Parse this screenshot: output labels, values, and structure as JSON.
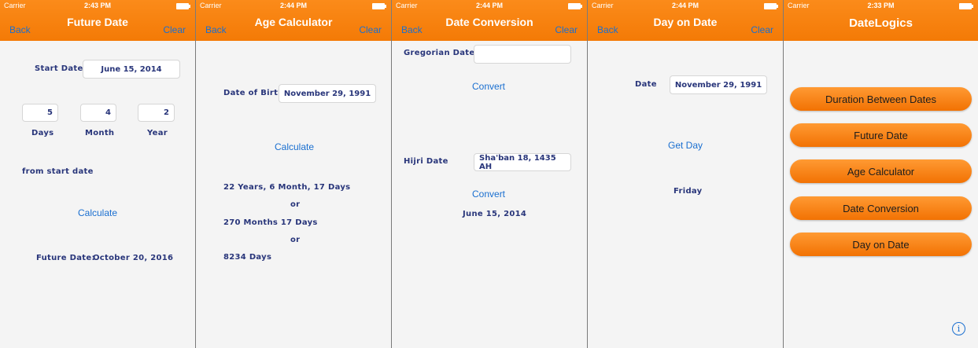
{
  "screens": [
    {
      "status": {
        "carrier": "Carrier",
        "time": "2:43 PM"
      },
      "nav": {
        "title": "Future Date",
        "left": "Back",
        "right": "Clear"
      },
      "start_date_label": "Start Date",
      "start_date_value": "June 15, 2014",
      "days_value": "5",
      "month_value": "4",
      "year_value": "2",
      "days_label": "Days",
      "month_label": "Month",
      "year_label": "Year",
      "from_label": "from start date",
      "calculate": "Calculate",
      "result_label": "Future Date:",
      "result_value": "October 20, 2016"
    },
    {
      "status": {
        "carrier": "Carrier",
        "time": "2:44 PM"
      },
      "nav": {
        "title": "Age Calculator",
        "left": "Back",
        "right": "Clear"
      },
      "dob_label": "Date of Birth",
      "dob_value": "November 29, 1991",
      "calculate": "Calculate",
      "result_line1": "22 Years, 6 Month, 17 Days",
      "or1": "or",
      "result_line2": "270 Months 17 Days",
      "or2": "or",
      "result_line3": "8234 Days"
    },
    {
      "status": {
        "carrier": "Carrier",
        "time": "2:44 PM"
      },
      "nav": {
        "title": "Date Conversion",
        "left": "Back",
        "right": "Clear"
      },
      "gregorian_label": "Gregorian Date",
      "gregorian_value": "",
      "convert1": "Convert",
      "hijri_label": "Hijri Date",
      "hijri_value": "Sha'ban 18, 1435 AH",
      "convert2": "Convert",
      "result_value": "June 15, 2014"
    },
    {
      "status": {
        "carrier": "Carrier",
        "time": "2:44 PM"
      },
      "nav": {
        "title": "Day on Date",
        "left": "Back",
        "right": "Clear"
      },
      "date_label": "Date",
      "date_value": "November 29, 1991",
      "get_day": "Get Day",
      "result_value": "Friday"
    },
    {
      "status": {
        "carrier": "Carrier",
        "time": "2:33 PM"
      },
      "nav": {
        "title": "DateLogics"
      },
      "menu": [
        "Duration Between Dates",
        "Future Date",
        "Age Calculator",
        "Date Conversion",
        "Day on Date"
      ],
      "info_icon": "info-icon"
    }
  ]
}
